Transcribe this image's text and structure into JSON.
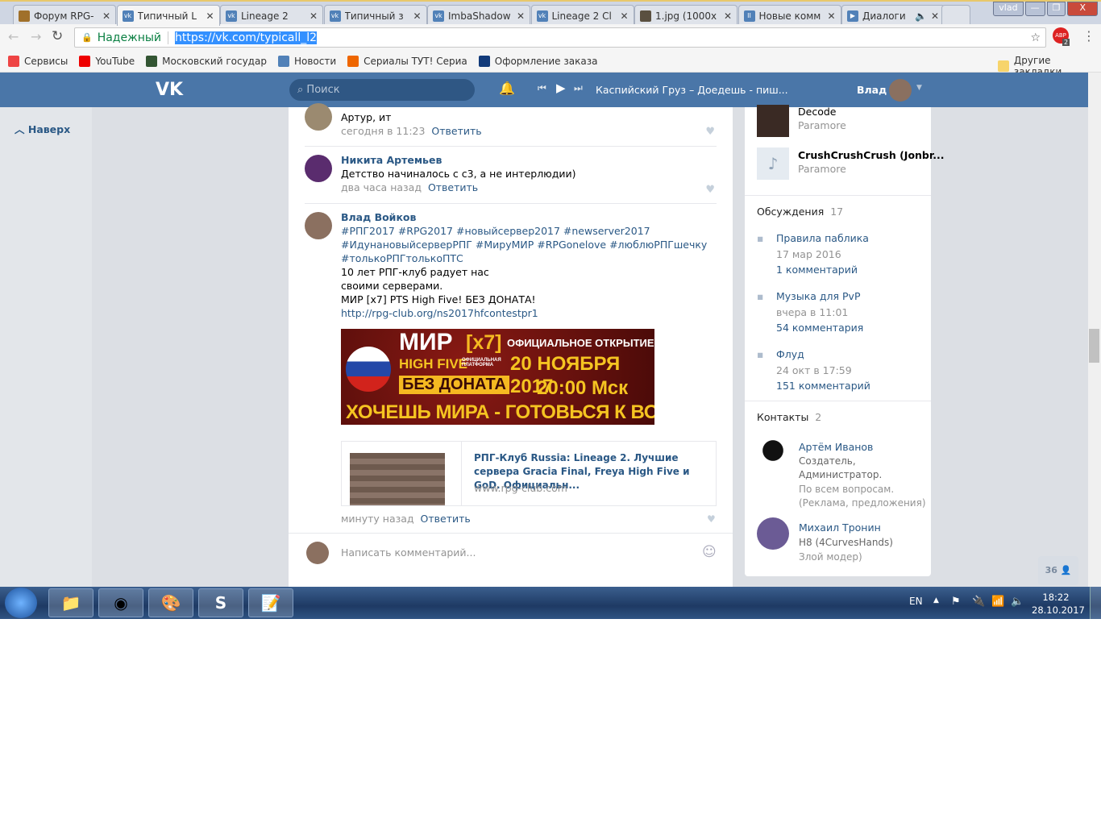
{
  "browser": {
    "tabs": [
      {
        "label": "Форум RPG-",
        "icon": "crest-icon"
      },
      {
        "label": "Типичный L",
        "icon": "vk-icon",
        "active": true
      },
      {
        "label": "Lineage 2",
        "icon": "vk-icon"
      },
      {
        "label": "Типичный з",
        "icon": "vk-icon"
      },
      {
        "label": "ImbaShadow",
        "icon": "vk-icon"
      },
      {
        "label": "Lineage 2 Cl",
        "icon": "vk-icon"
      },
      {
        "label": "1.jpg (1000x",
        "icon": "image-icon"
      },
      {
        "label": "Новые комм",
        "icon": "pause-icon"
      },
      {
        "label": "Диалоги",
        "icon": "play-icon",
        "audio": true
      }
    ],
    "user": "vlad",
    "secure_label": "Надежный",
    "url": "https://vk.com/typicall_l2",
    "abp_count": "2",
    "bookmarks": [
      {
        "label": "Сервисы",
        "color": "#e44"
      },
      {
        "label": "YouTube",
        "color": "#e00"
      },
      {
        "label": "Московский государ",
        "color": "#353"
      },
      {
        "label": "Новости",
        "color": "#5181b8"
      },
      {
        "label": "Сериалы ТУТ! Сериа",
        "color": "#e60"
      },
      {
        "label": "Оформление заказа",
        "color": "#123a7a"
      }
    ],
    "other_bookmarks": "Другие закладки"
  },
  "vk": {
    "search_placeholder": "Поиск",
    "track": "Каспийский Груз – Доедешь - пиш...",
    "user": "Влад",
    "back_top": "Наверх"
  },
  "comments": [
    {
      "author": "",
      "text": "Артур, ит",
      "time": "сегодня в 11:23",
      "reply": "Ответить"
    },
    {
      "author": "Никита Артемьев",
      "text": "Детство начиналось с с3, а не интерлюдии)",
      "time": "два часа назад",
      "reply": "Ответить"
    },
    {
      "author": "Влад Войков",
      "lines": [
        "#РПГ2017 #RPG2017 #новыйсервер2017 #newserver2017",
        "#ИдунановыйсерверРПГ #МируМИР #RPGonelove #люблюРПГшечку",
        "#толькоРПГтолькоПТС"
      ],
      "text_lines": [
        "10 лет РПГ-клуб радует нас",
        "своими серверами.",
        "МИР [x7] PTS High Five! БЕЗ ДОНАТА!"
      ],
      "link": "http://rpg-club.org/ns2017hfcontestpr1",
      "time": "минуту назад",
      "reply": "Ответить"
    }
  ],
  "banner": {
    "title": "МИР",
    "rate": "[x7]",
    "sub": "HIGH FIVE",
    "platform": "ОФИЦИАЛЬНАЯ ПЛАТФОРМА",
    "nodonate": "БЕЗ ДОНАТА",
    "opening": "ОФИЦИАЛЬНОЕ ОТКРЫТИЕ",
    "date": "20 НОЯБРЯ 2017",
    "time": "20:00 Мск",
    "slogan": "ХОЧЕШЬ МИРА - ГОТОВЬСЯ К ВОЙНЕ"
  },
  "link_card": {
    "title": "РПГ-Клуб Russia: Lineage 2. Лучшие сервера Gracia Final, Freya High Five и GoD. Официальн...",
    "domain": "www.rpg-club.com"
  },
  "comment_placeholder": "Написать комментарий...",
  "audio": [
    {
      "title": "Decode",
      "artist": "Paramore"
    },
    {
      "title": "CrushCrushCrush (Jonbr...",
      "artist": "Paramore"
    }
  ],
  "discussions": {
    "title": "Обсуждения",
    "count": "17",
    "items": [
      {
        "title": "Правила паблика",
        "date": "17 мар 2016",
        "comments": "1 комментарий"
      },
      {
        "title": "Музыка для PvP",
        "date": "вчера в 11:01",
        "comments": "54 комментария"
      },
      {
        "title": "Флуд",
        "date": "24 окт в 17:59",
        "comments": "151 комментарий"
      }
    ]
  },
  "contacts": {
    "title": "Контакты",
    "count": "2",
    "items": [
      {
        "name": "Артём Иванов",
        "desc": [
          "Создатель,",
          "Администратор.",
          "По всем вопросам.",
          "(Реклама, предложения)"
        ]
      },
      {
        "name": "Михаил Тронин",
        "desc": [
          "Н8 (4CurvesHands)",
          "Злой модер)"
        ]
      }
    ]
  },
  "online_count": "36",
  "taskbar": {
    "lang": "EN",
    "time": "18:22",
    "date": "28.10.2017"
  }
}
